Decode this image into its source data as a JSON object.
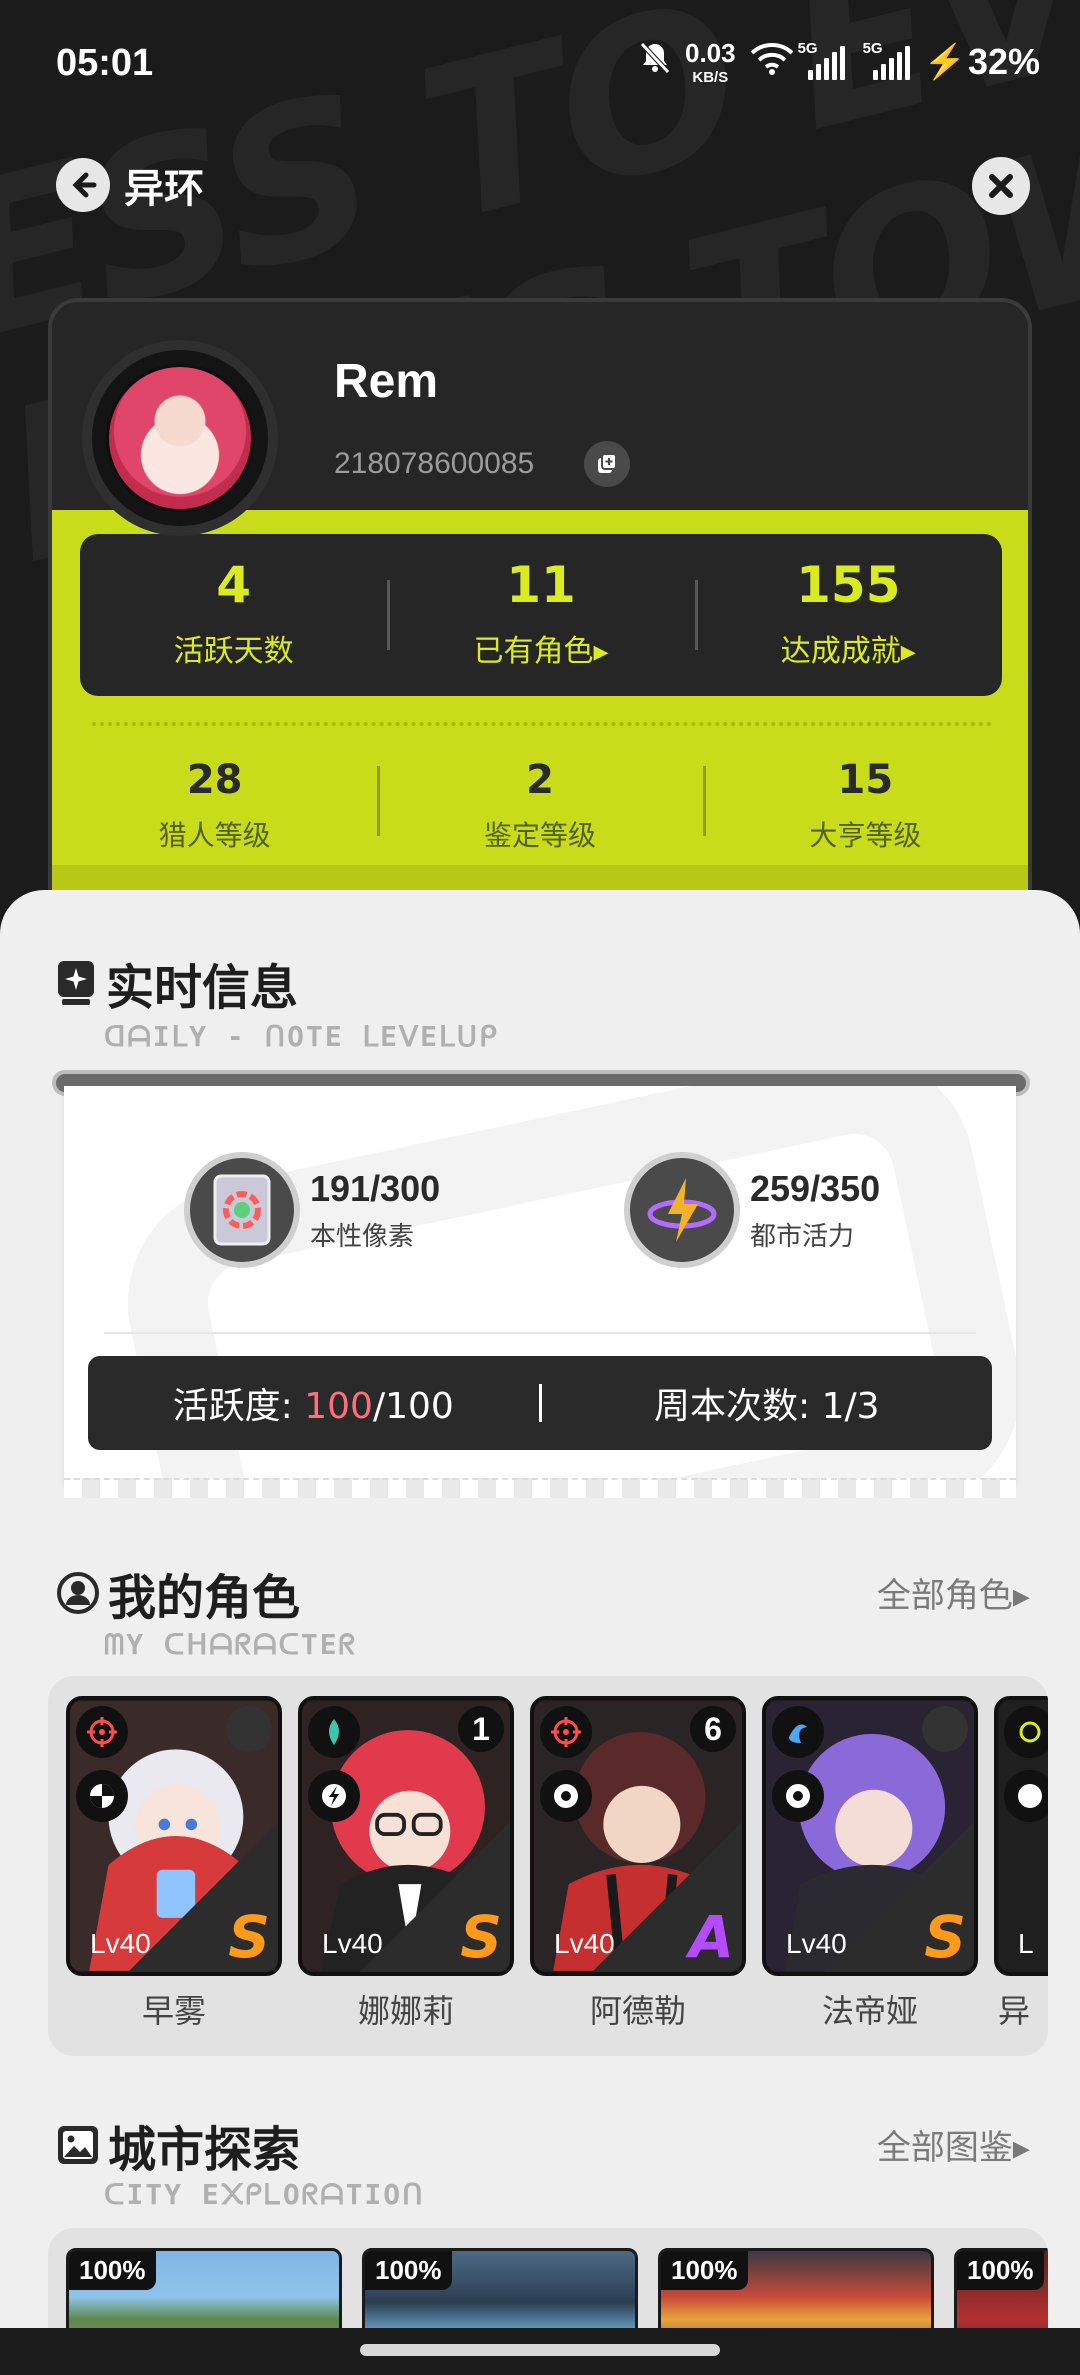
{
  "status_bar": {
    "time": "05:01",
    "net_speed": "0.03",
    "net_unit": "KB/S",
    "sim1": "5G",
    "sim2": "5G",
    "battery": "32%"
  },
  "header": {
    "title": "异环"
  },
  "profile": {
    "name": "Rem",
    "uid": "218078600085",
    "stats": [
      {
        "value": "4",
        "label": "活跃天数"
      },
      {
        "value": "11",
        "label": "已有角色▸"
      },
      {
        "value": "155",
        "label": "达成成就▸"
      }
    ],
    "levels": [
      {
        "value": "28",
        "label": "猎人等级"
      },
      {
        "value": "2",
        "label": "鉴定等级"
      },
      {
        "value": "15",
        "label": "大亨等级"
      }
    ]
  },
  "realtime": {
    "title": "实时信息",
    "subtitle": "ᗡᗩIᒪY - ᑎOTE ᒪEᐯEᒪᑌᑭ",
    "resources": [
      {
        "value": "191/300",
        "label": "本性像素",
        "icon": "prism-card-icon"
      },
      {
        "value": "259/350",
        "label": "都市活力",
        "icon": "lightning-orb-icon"
      }
    ],
    "activity": {
      "label": "活跃度: ",
      "current": "100",
      "total": "/100"
    },
    "weekly": {
      "label": "周本次数: ",
      "value": "1/3"
    }
  },
  "characters": {
    "title": "我的角色",
    "subtitle": "ᗰY ᑕᕼᗩᖇᗩᑕTEᖇ",
    "more": "全部角色▸",
    "items": [
      {
        "name": "早雾",
        "level": "Lv40",
        "rank": "S",
        "mind": ""
      },
      {
        "name": "娜娜莉",
        "level": "Lv40",
        "rank": "S",
        "mind": "1"
      },
      {
        "name": "阿德勒",
        "level": "Lv40",
        "rank": "A",
        "mind": "6"
      },
      {
        "name": "法帝娅",
        "level": "Lv40",
        "rank": "S",
        "mind": ""
      },
      {
        "name": "异",
        "level": "L",
        "rank": "",
        "mind": ""
      }
    ]
  },
  "city": {
    "title": "城市探索",
    "subtitle": "ᑕITY E᙭ᑭᒪOᖇᗩTIOᑎ",
    "more": "全部图鉴▸",
    "items": [
      {
        "percent": "100%"
      },
      {
        "percent": "100%"
      },
      {
        "percent": "100%"
      },
      {
        "percent": "100%"
      }
    ]
  },
  "colors": {
    "accent_lime": "#c9dc1a",
    "rank_s": "#ff9a1a",
    "rank_a": "#b54bff",
    "activity_red": "#ff6e7a"
  }
}
